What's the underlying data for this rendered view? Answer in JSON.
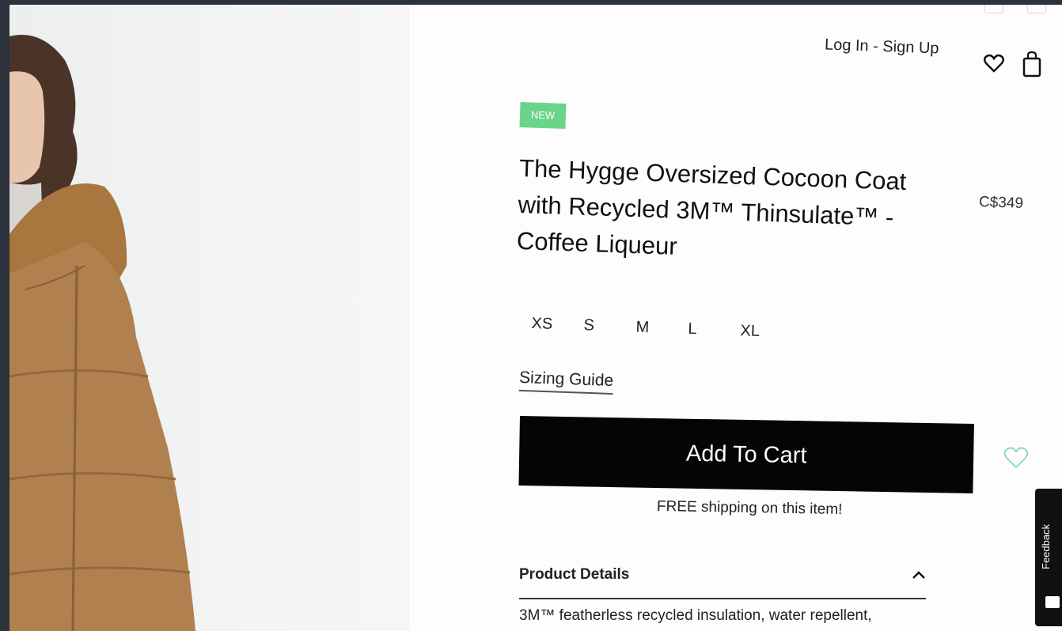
{
  "header": {
    "auth_link": "Log In - Sign Up",
    "icons": [
      "heart-icon",
      "shopping-bag-icon"
    ]
  },
  "product": {
    "badge": "NEW",
    "title": "The Hygge Oversized Cocoon Coat with Recycled 3M™ Thinsulate™ - Coffee Liqueur",
    "price": "C$349",
    "sizes": [
      "XS",
      "S",
      "M",
      "L",
      "XL"
    ],
    "sizing_guide": "Sizing Guide",
    "add_to_cart": "Add To Cart",
    "shipping_note": "FREE shipping on this item!"
  },
  "details": {
    "heading": "Product Details",
    "text": "3M™ featherless recycled insulation, water repellent,"
  },
  "feedback": {
    "label": "Feedback"
  },
  "colors": {
    "badge": "#6ad48a",
    "button": "#050505",
    "wishlist_heart": "#8fd8c8",
    "coat": "#b0804f"
  }
}
